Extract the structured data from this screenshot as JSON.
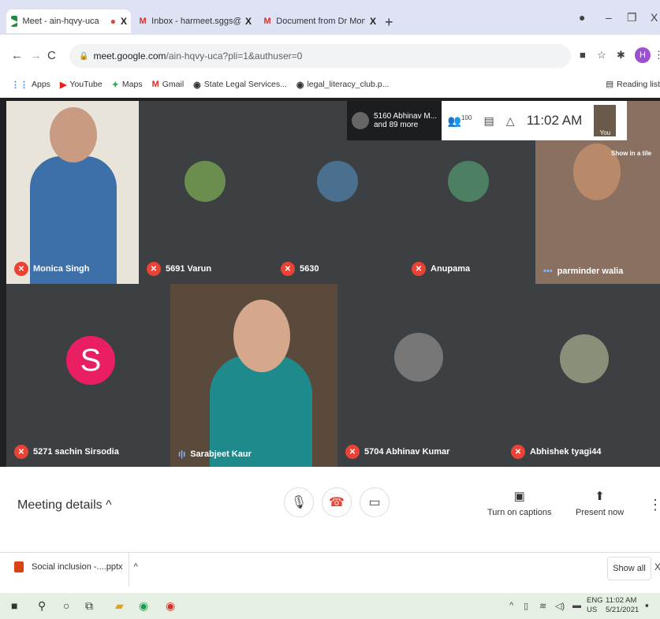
{
  "browser": {
    "tabs": [
      {
        "title": "Meet - ain-hqvy-uca",
        "icon": "meet-icon",
        "active": true
      },
      {
        "title": "Inbox - harmeet.sggs@gmail.co",
        "icon": "gmail-icon",
        "active": false
      },
      {
        "title": "Document from Dr Monica M Si",
        "icon": "gmail-icon",
        "active": false
      }
    ],
    "new_tab": "+",
    "window_controls": {
      "minimize": "–",
      "maximize": "❐",
      "close": "X"
    },
    "url_host": "meet.google.com",
    "url_path": "/ain-hqvy-uca?pli=1&authuser=0",
    "profile_initial": "H",
    "bookmarks": [
      {
        "label": "Apps",
        "icon": "apps-grid-icon"
      },
      {
        "label": "YouTube",
        "icon": "youtube-icon"
      },
      {
        "label": "Maps",
        "icon": "maps-icon"
      },
      {
        "label": "Gmail",
        "icon": "gmail-icon"
      },
      {
        "label": "State Legal Services...",
        "icon": "globe-icon"
      },
      {
        "label": "legal_literacy_club.p...",
        "icon": "globe-icon"
      }
    ],
    "reading_list": "Reading list"
  },
  "meet": {
    "presenter_text": "5160 Abhinav M...",
    "presenter_more": "and 89 more",
    "participant_count": "100",
    "clock": "11:02 AM",
    "self_label": "You",
    "show_in_tile": "Show in a tile",
    "participants": [
      {
        "name": "Monica Singh",
        "muted": true,
        "type": "video"
      },
      {
        "name": "5691 Varun",
        "muted": true,
        "type": "avatar"
      },
      {
        "name": "5630",
        "muted": true,
        "type": "avatar"
      },
      {
        "name": "Anupama",
        "muted": true,
        "type": "avatar"
      },
      {
        "name": "parminder walia",
        "muted": false,
        "type": "video"
      },
      {
        "name": "5271 sachin Sirsodia",
        "muted": true,
        "type": "initial",
        "initial": "S"
      },
      {
        "name": "Sarabjeet Kaur",
        "muted": false,
        "type": "video"
      },
      {
        "name": "5704 Abhinav Kumar",
        "muted": true,
        "type": "avatar"
      },
      {
        "name": "Abhishek tyagi44",
        "muted": true,
        "type": "avatar"
      }
    ],
    "controls": {
      "meeting_details": "Meeting details",
      "captions": "Turn on captions",
      "present": "Present now"
    }
  },
  "downloads": {
    "file": "Social inclusion -....pptx",
    "show_all": "Show all"
  },
  "taskbar": {
    "lang1": "ENG",
    "lang2": "US",
    "time": "11:02 AM",
    "date": "5/21/2021"
  },
  "colors": {
    "meet_bg": "#202124",
    "tile_bg": "#3c4043",
    "mute_red": "#ea4335",
    "initial_pink": "#e91e63",
    "tab_strip": "#dfe1f5",
    "taskbar": "#e5efe4"
  }
}
